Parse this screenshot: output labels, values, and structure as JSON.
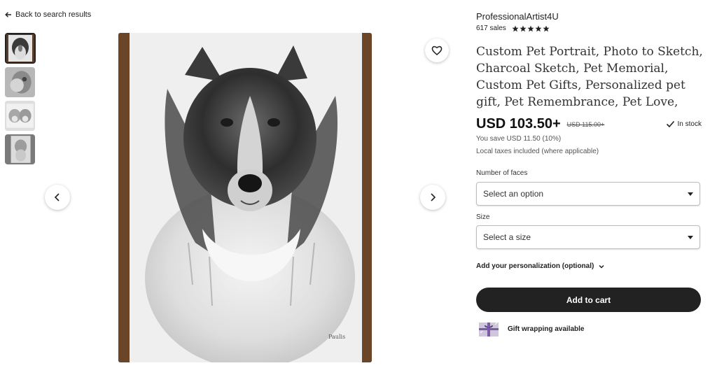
{
  "nav": {
    "back_label": "Back to search results"
  },
  "thumbnails": [
    {
      "name": "thumb-collie"
    },
    {
      "name": "thumb-dog-sketch-2"
    },
    {
      "name": "thumb-dogs-pair"
    },
    {
      "name": "thumb-dog-sketch-4"
    }
  ],
  "main_image": {
    "signature": "Paulis"
  },
  "shop": {
    "name": "ProfessionalArtist4U",
    "sales": "617 sales",
    "rating": 5
  },
  "listing": {
    "title": "Custom Pet Portrait, Photo to Sketch, Charcoal Sketch, Pet Memorial, Custom Pet Gifts, Personalized pet gift, Pet Remembrance, Pet Love,",
    "price": "USD 103.50+",
    "original_price": "USD 115.00+",
    "stock": "In stock",
    "savings": "You save USD 11.50 (10%)",
    "tax_note": "Local taxes included (where applicable)"
  },
  "options": {
    "faces_label": "Number of faces",
    "faces_value": "Select an option",
    "size_label": "Size",
    "size_value": "Select a size"
  },
  "personalization": {
    "label": "Add your personalization (optional)"
  },
  "actions": {
    "add_to_cart": "Add to cart"
  },
  "gift": {
    "label": "Gift wrapping available"
  },
  "colors": {
    "accent": "#222222",
    "price": "#111111",
    "gift_ribbon": "#7b5aa6"
  }
}
